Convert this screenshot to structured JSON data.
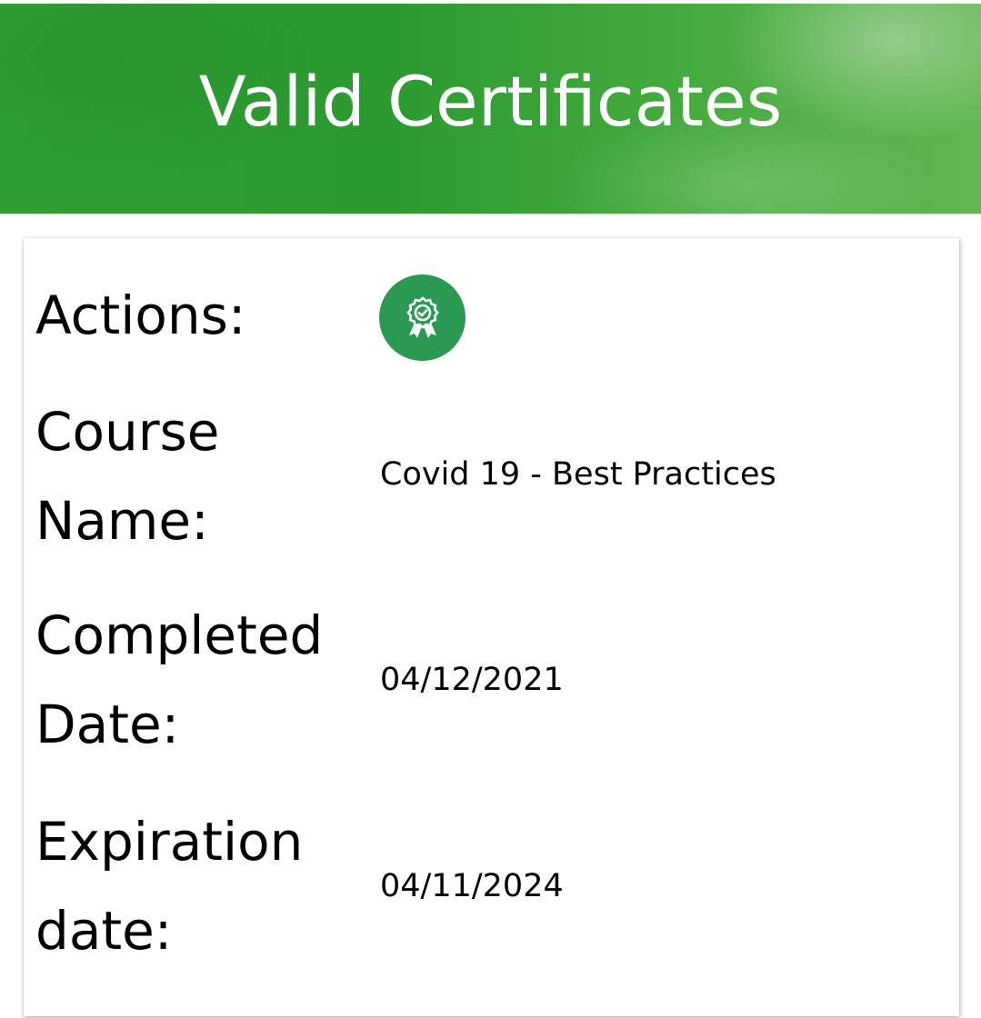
{
  "header": {
    "title": "Valid Certificates"
  },
  "certificate": {
    "actions_label": "Actions:",
    "action_icon": "certificate-badge-icon",
    "course_label_line1": "Course",
    "course_label_line2": "Name:",
    "course_name": "Covid 19 - Best Practices",
    "completed_label_line1": "Completed",
    "completed_label_line2": "Date:",
    "completed_date": "04/12/2021",
    "expiration_label_line1": "Expiration",
    "expiration_label_line2": "date:",
    "expiration_date": "04/11/2024"
  },
  "colors": {
    "banner_green": "#2c9a30",
    "action_button_green": "#2a9a52"
  }
}
